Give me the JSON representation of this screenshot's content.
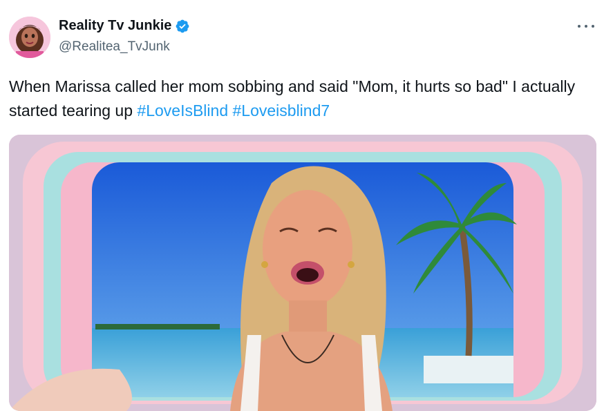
{
  "tweet": {
    "author": {
      "display_name": "Reality Tv Junkie",
      "handle": "@Realitea_TvJunk",
      "verified": true,
      "avatar_icon": "cartoon-woman-avatar-icon"
    },
    "text": {
      "body": "When Marissa called her mom sobbing and said \"Mom, it hurts so bad\" I actually started tearing up ",
      "hashtags": [
        "#LoveIsBlind",
        "#Loveisblind7"
      ]
    },
    "more_icon": "more-options-icon",
    "media": {
      "type": "image",
      "description_icon": "tweet-photo"
    }
  },
  "colors": {
    "verified": "#1d9bf0",
    "link": "#1d9bf0",
    "text": "#0f1419",
    "secondary": "#536471"
  }
}
